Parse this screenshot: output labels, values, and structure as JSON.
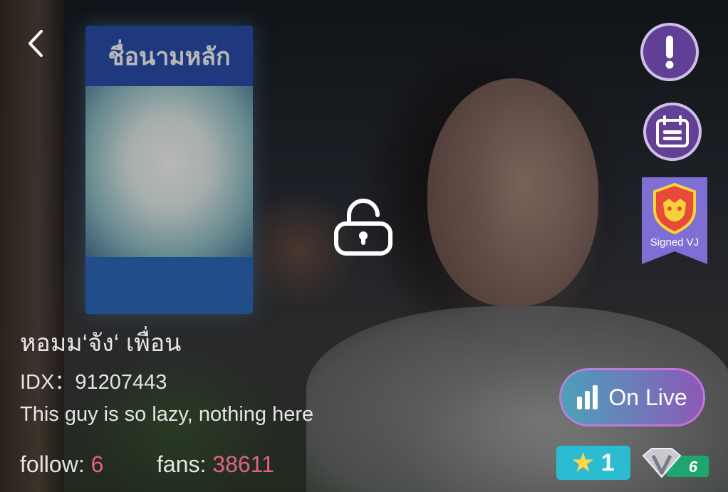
{
  "profile": {
    "name": "หอมม‘จัง‘ เพื่อน",
    "idx": "IDX：91207443",
    "bio": "This guy is so lazy, nothing here",
    "follow_label": "follow:",
    "follow_count": "6",
    "fans_label": "fans:",
    "fans_count": "38611"
  },
  "background": {
    "billboard_text": "ชื่อนามหลัก"
  },
  "actions": {
    "back_icon": "chevron-left-icon",
    "report_icon": "exclamation-icon",
    "calendar_icon": "calendar-icon",
    "lock_icon": "unlocked-padlock-icon"
  },
  "badges": {
    "vj_label": "Signed VJ",
    "live_label": "On Live",
    "level": "1",
    "vip_level": "6"
  },
  "colors": {
    "count_accent": "#e0637f",
    "action_purple": "#6e46aa",
    "level_badge": "#2bbcd2",
    "vip_green": "#1fa56e"
  }
}
